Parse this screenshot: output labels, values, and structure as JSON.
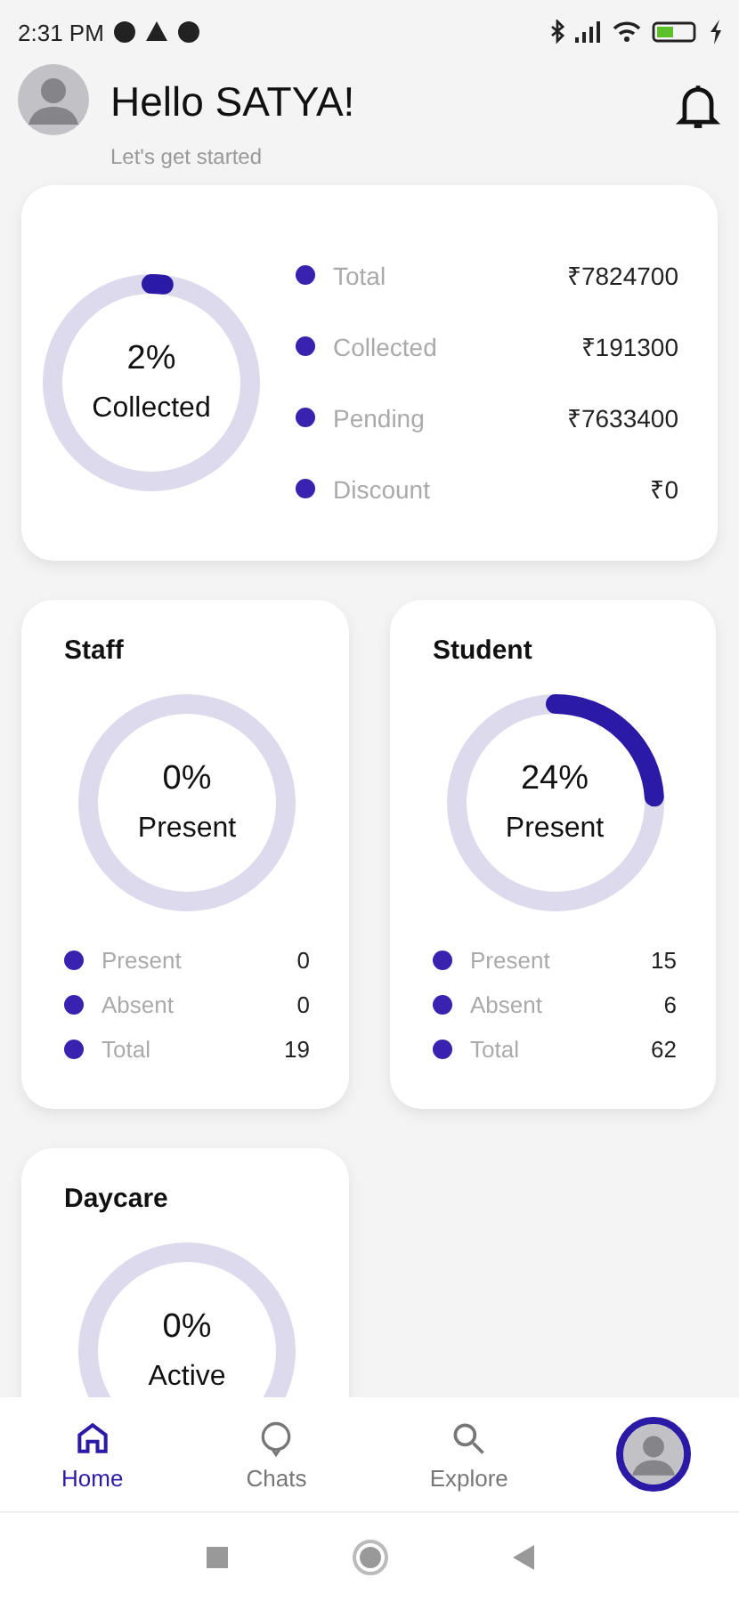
{
  "status_bar": {
    "time": "2:31 PM"
  },
  "header": {
    "greeting": "Hello SATYA!",
    "subtitle": "Let's get started"
  },
  "fees": {
    "percent": "2%",
    "caption": "Collected",
    "items": [
      {
        "label": "Total",
        "value": "₹7824700",
        "color": "#3a22b0"
      },
      {
        "label": "Collected",
        "value": "₹191300",
        "color": "#3a22b0"
      },
      {
        "label": "Pending",
        "value": "₹7633400",
        "color": "#3a22b0"
      },
      {
        "label": "Discount",
        "value": "₹0",
        "color": "#3a22b0"
      }
    ]
  },
  "cards": [
    {
      "title": "Staff",
      "percent": "0%",
      "caption": "Present",
      "items": [
        {
          "label": "Present",
          "value": "0",
          "color": "#3a22b0"
        },
        {
          "label": "Absent",
          "value": "0",
          "color": "#3a22b0"
        },
        {
          "label": "Total",
          "value": "19",
          "color": "#3a22b0"
        }
      ]
    },
    {
      "title": "Student",
      "percent": "24%",
      "caption": "Present",
      "items": [
        {
          "label": "Present",
          "value": "15",
          "color": "#3a22b0"
        },
        {
          "label": "Absent",
          "value": "6",
          "color": "#3a22b0"
        },
        {
          "label": "Total",
          "value": "62",
          "color": "#3a22b0"
        }
      ]
    },
    {
      "title": "Daycare",
      "percent": "0%",
      "caption": "Active"
    }
  ],
  "bottom_nav": [
    {
      "label": "Home",
      "kind": "tab",
      "selected": true
    },
    {
      "label": "Chats",
      "kind": "tab",
      "selected": false
    },
    {
      "label": "Explore",
      "kind": "tab",
      "selected": false
    },
    {
      "kind": "profile",
      "selected": false
    }
  ]
}
